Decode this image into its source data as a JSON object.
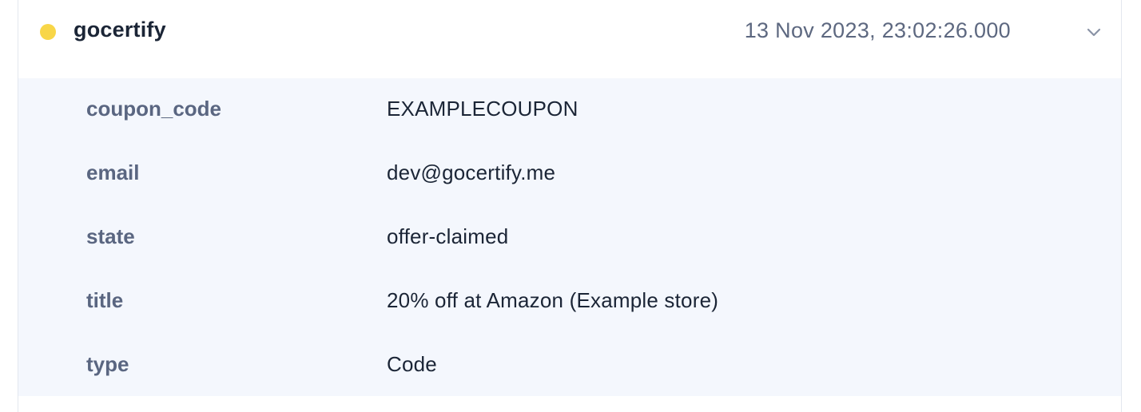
{
  "event": {
    "source": "gocertify",
    "timestamp": "13 Nov 2023, 23:02:26.000",
    "status_color": "#f8d648"
  },
  "properties": [
    {
      "key": "coupon_code",
      "value": "EXAMPLECOUPON"
    },
    {
      "key": "email",
      "value": "dev@gocertify.me"
    },
    {
      "key": "state",
      "value": "offer-claimed"
    },
    {
      "key": "title",
      "value": "20% off at Amazon (Example store)"
    },
    {
      "key": "type",
      "value": "Code"
    }
  ],
  "icons": {
    "status": "status-dot-icon",
    "toggle": "chevron-down-icon"
  }
}
